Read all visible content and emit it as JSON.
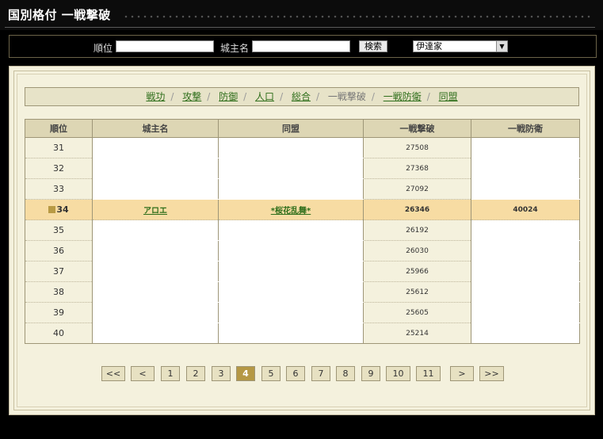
{
  "header": {
    "title": "国別格付 一戦撃破"
  },
  "search": {
    "rank_label": "順位",
    "lord_label": "城主名",
    "rank_value": "",
    "lord_value": "",
    "button_label": "検索",
    "country_selected": "伊達家"
  },
  "tabs": [
    {
      "label": "戦功",
      "active": false
    },
    {
      "label": "攻撃",
      "active": false
    },
    {
      "label": "防御",
      "active": false
    },
    {
      "label": "人口",
      "active": false
    },
    {
      "label": "総合",
      "active": false
    },
    {
      "label": "一戦撃破",
      "active": true
    },
    {
      "label": "一戦防衛",
      "active": false
    },
    {
      "label": "同盟",
      "active": false
    }
  ],
  "table": {
    "headers": [
      "順位",
      "城主名",
      "同盟",
      "一戦撃破",
      "一戦防衛"
    ],
    "rows": [
      {
        "rank": "31",
        "lord": "",
        "alliance": "",
        "attack": "27508",
        "defense": ""
      },
      {
        "rank": "32",
        "lord": "",
        "alliance": "",
        "attack": "27368",
        "defense": ""
      },
      {
        "rank": "33",
        "lord": "",
        "alliance": "",
        "attack": "27092",
        "defense": ""
      },
      {
        "rank": "34",
        "lord": "アロエ",
        "alliance": "*桜花乱舞*",
        "attack": "26346",
        "defense": "40024",
        "highlight": true
      },
      {
        "rank": "35",
        "lord": "",
        "alliance": "",
        "attack": "26192",
        "defense": ""
      },
      {
        "rank": "36",
        "lord": "",
        "alliance": "",
        "attack": "26030",
        "defense": ""
      },
      {
        "rank": "37",
        "lord": "",
        "alliance": "",
        "attack": "25966",
        "defense": ""
      },
      {
        "rank": "38",
        "lord": "",
        "alliance": "",
        "attack": "25612",
        "defense": ""
      },
      {
        "rank": "39",
        "lord": "",
        "alliance": "",
        "attack": "25605",
        "defense": ""
      },
      {
        "rank": "40",
        "lord": "",
        "alliance": "",
        "attack": "25214",
        "defense": ""
      }
    ]
  },
  "pagination": {
    "first": "<<",
    "prev": "<",
    "pages": [
      "1",
      "2",
      "3",
      "4",
      "5",
      "6",
      "7",
      "8",
      "9",
      "10",
      "11"
    ],
    "current": "4",
    "next": ">",
    "last": ">>"
  },
  "colors": {
    "accent": "#b59845",
    "highlight_row": "#f7dca3",
    "link": "#2e6e1a"
  }
}
